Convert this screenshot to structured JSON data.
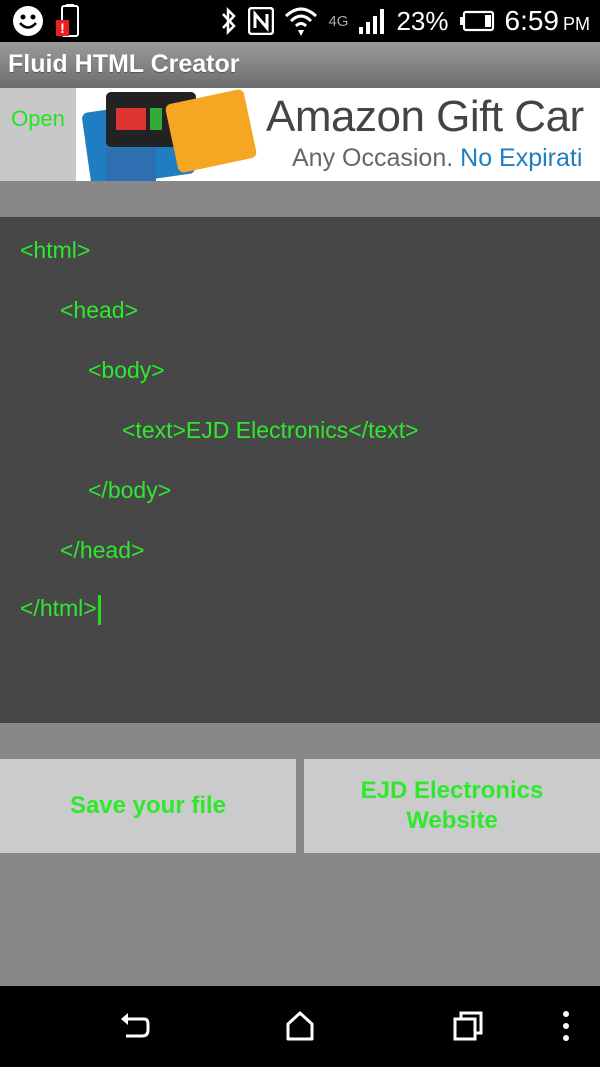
{
  "status_bar": {
    "battery_percent": "23%",
    "time": "6:59",
    "ampm": "PM",
    "network": "4G"
  },
  "app": {
    "title": "Fluid HTML Creator"
  },
  "toolbar": {
    "open_label": "Open"
  },
  "ad": {
    "title": "Amazon Gift Car",
    "subtitle_gray": "Any Occasion.",
    "subtitle_blue": " No Expirati"
  },
  "editor": {
    "lines": [
      "<html>",
      "<head>",
      "<body>",
      "<text>EJD Electronics</text>",
      "</body>",
      "</head>",
      "</html>"
    ]
  },
  "buttons": {
    "save": "Save your file",
    "website": "EJD Electronics Website"
  },
  "colors": {
    "code_green": "#2ee82e",
    "editor_bg": "#474747",
    "button_bg": "#cbcbcb",
    "page_bg": "#888888",
    "ad_blue": "#1f7ec2"
  }
}
